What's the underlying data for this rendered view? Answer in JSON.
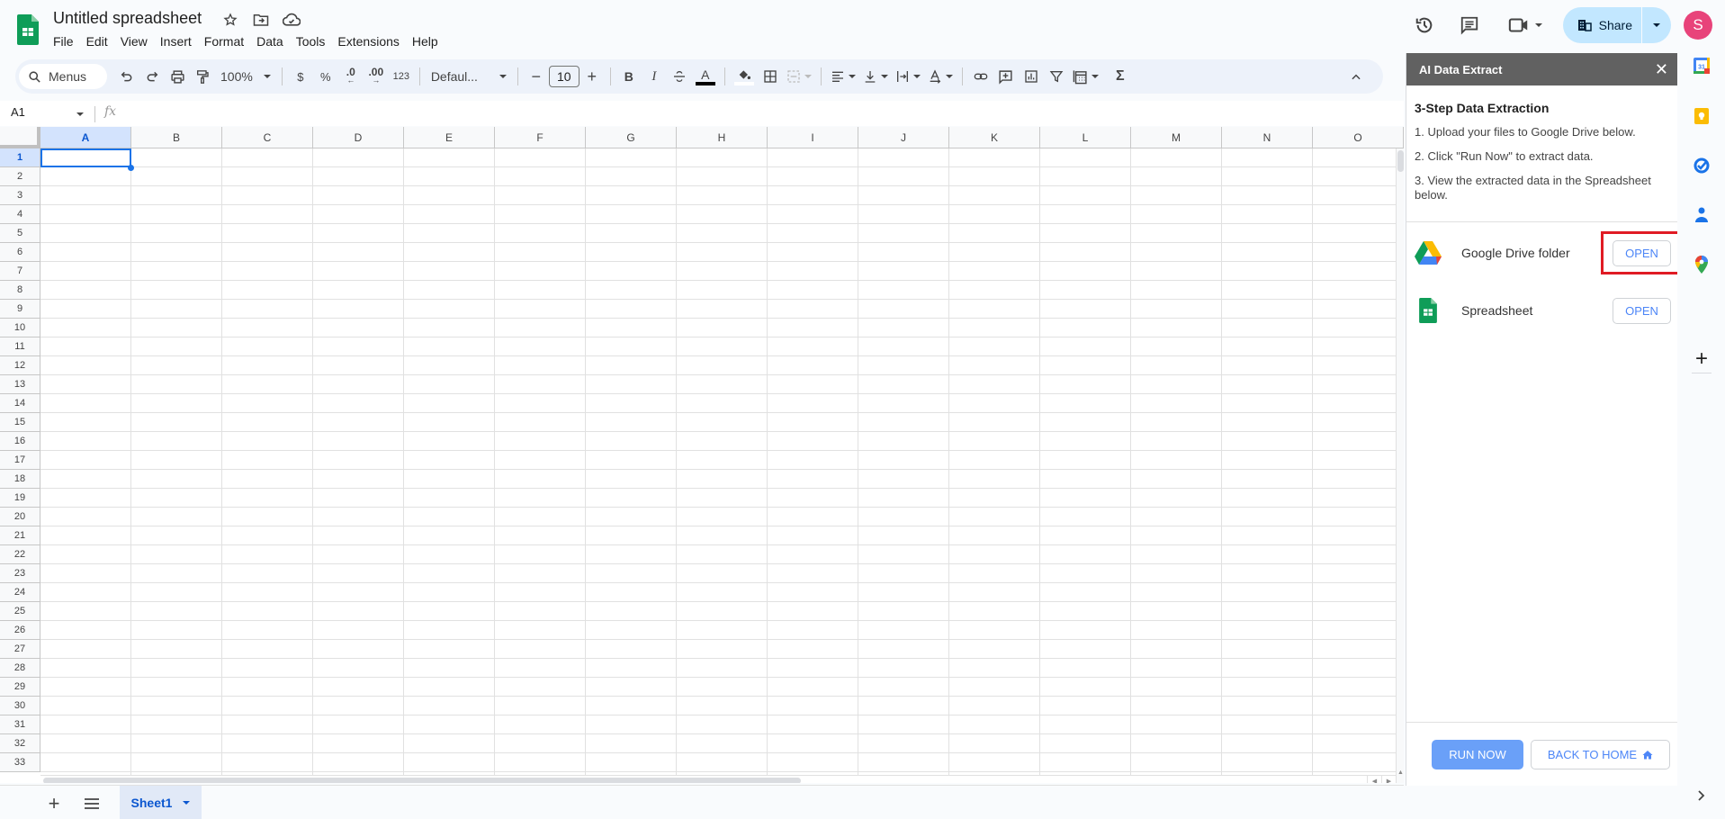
{
  "document": {
    "title": "Untitled spreadsheet"
  },
  "menu": [
    "File",
    "Edit",
    "View",
    "Insert",
    "Format",
    "Data",
    "Tools",
    "Extensions",
    "Help"
  ],
  "header_right": {
    "share_label": "Share",
    "avatar_initial": "S"
  },
  "toolbar": {
    "search_label": "Menus",
    "zoom": "100%",
    "currency": "$",
    "percent": "%",
    "decrease_decimal": ".0",
    "increase_decimal": ".00",
    "number_format": "123",
    "font": "Defaul...",
    "font_size": "10",
    "bold": "B",
    "italic": "I",
    "sum": "Σ"
  },
  "formula_bar": {
    "cell_ref": "A1",
    "fx": "fx",
    "value": ""
  },
  "grid": {
    "columns": [
      "A",
      "B",
      "C",
      "D",
      "E",
      "F",
      "G",
      "H",
      "I",
      "J",
      "K",
      "L",
      "M",
      "N",
      "O"
    ],
    "rows": [
      "1",
      "2",
      "3",
      "4",
      "5",
      "6",
      "7",
      "8",
      "9",
      "10",
      "11",
      "12",
      "13",
      "14",
      "15",
      "16",
      "17",
      "18",
      "19",
      "20",
      "21",
      "22",
      "23",
      "24",
      "25",
      "26",
      "27",
      "28",
      "29",
      "30",
      "31",
      "32",
      "33"
    ],
    "selected_cell": "A1"
  },
  "sheets": [
    {
      "name": "Sheet1",
      "active": true
    }
  ],
  "panel": {
    "title": "AI Data Extract",
    "heading": "3-Step Data Extraction",
    "steps": [
      "1. Upload your files to Google Drive below.",
      "2. Click \"Run Now\" to extract data.",
      "3. View the extracted data in the Spreadsheet below."
    ],
    "links": [
      {
        "label": "Google Drive folder",
        "button": "OPEN",
        "icon": "google-drive-icon",
        "highlighted": true
      },
      {
        "label": "Spreadsheet",
        "button": "OPEN",
        "icon": "google-sheets-icon",
        "highlighted": false
      }
    ],
    "run_button": "RUN NOW",
    "home_button": "BACK TO HOME"
  },
  "side_rail": [
    "calendar-icon",
    "keep-icon",
    "tasks-icon",
    "contacts-icon",
    "maps-icon",
    "add-icon"
  ],
  "colors": {
    "accent": "#1a73e8",
    "share_bg": "#c2e7ff",
    "panel_header": "#616161",
    "run_button": "#6aa0f8",
    "highlight": "#e01b24",
    "avatar": "#e8437a"
  }
}
